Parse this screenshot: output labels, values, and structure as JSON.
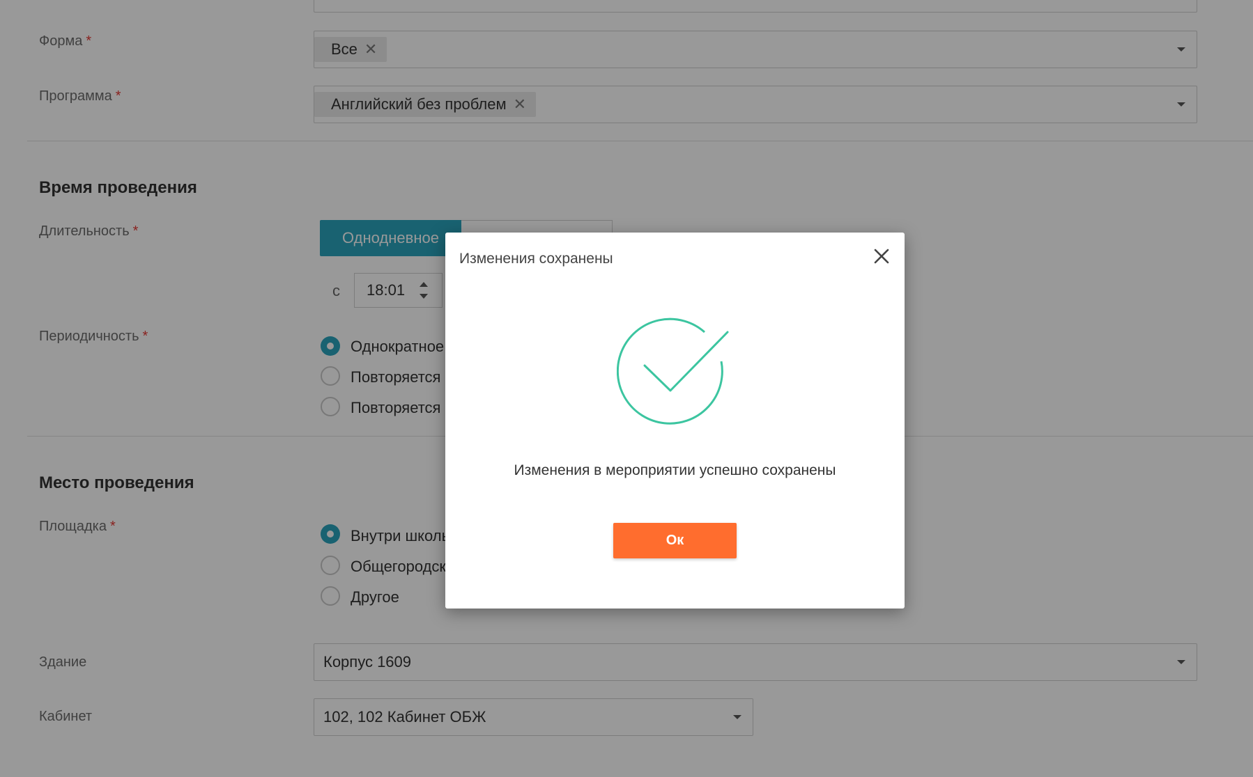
{
  "form_fields": {
    "forma": {
      "label": "Форма",
      "required_mark": "*",
      "chip": "Все"
    },
    "programma": {
      "label": "Программа",
      "required_mark": "*",
      "chip": "Английский без проблем"
    }
  },
  "time_section": {
    "title": "Время проведения",
    "duration": {
      "label": "Длительность",
      "required_mark": "*",
      "options": [
        "Однодневное"
      ]
    },
    "time_from": {
      "prefix": "с",
      "value": "18:01"
    },
    "periodicity": {
      "label": "Периодичность",
      "required_mark": "*",
      "options": [
        "Однократное",
        "Повторяется",
        "Повторяется"
      ],
      "selected_index": 0
    }
  },
  "place_section": {
    "title": "Место проведения",
    "site": {
      "label": "Площадка",
      "required_mark": "*",
      "options": [
        "Внутри школы",
        "Общегородская",
        "Другое"
      ],
      "selected_index": 0
    },
    "building": {
      "label": "Здание",
      "value": "Корпус 1609"
    },
    "cabinet": {
      "label": "Кабинет",
      "value": "102, 102 Кабинет ОБЖ"
    }
  },
  "modal": {
    "title": "Изменения сохранены",
    "message": "Изменения в мероприятии успешно сохранены",
    "ok_label": "Ок"
  },
  "colors": {
    "accent_teal": "#2aa3bd",
    "success_green": "#3cc5a0",
    "ok_orange": "#ff6d2e"
  },
  "icons": {
    "chip_remove": "close-icon",
    "dropdown": "chevron-down-icon",
    "modal_close": "close-icon",
    "success": "check-circle-icon"
  }
}
